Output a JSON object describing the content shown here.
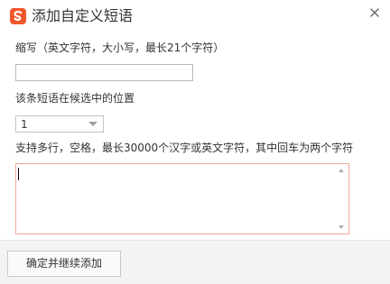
{
  "window": {
    "title": "添加自定义短语",
    "logo_icon": "sogou-s-logo-icon",
    "close_icon": "close-icon",
    "accent_color": "#f0562c"
  },
  "abbreviation": {
    "label": "缩写（英文字符，大小写，最长21个字符）",
    "value": ""
  },
  "position": {
    "label": "该条短语在候选中的位置",
    "selected": "1"
  },
  "content": {
    "label": "支持多行，空格，最长30000个汉字或英文字符，其中回车为两个字符",
    "value": "",
    "border_color": "#f0a890"
  },
  "footer": {
    "confirm_continue_label": "确定并继续添加"
  }
}
